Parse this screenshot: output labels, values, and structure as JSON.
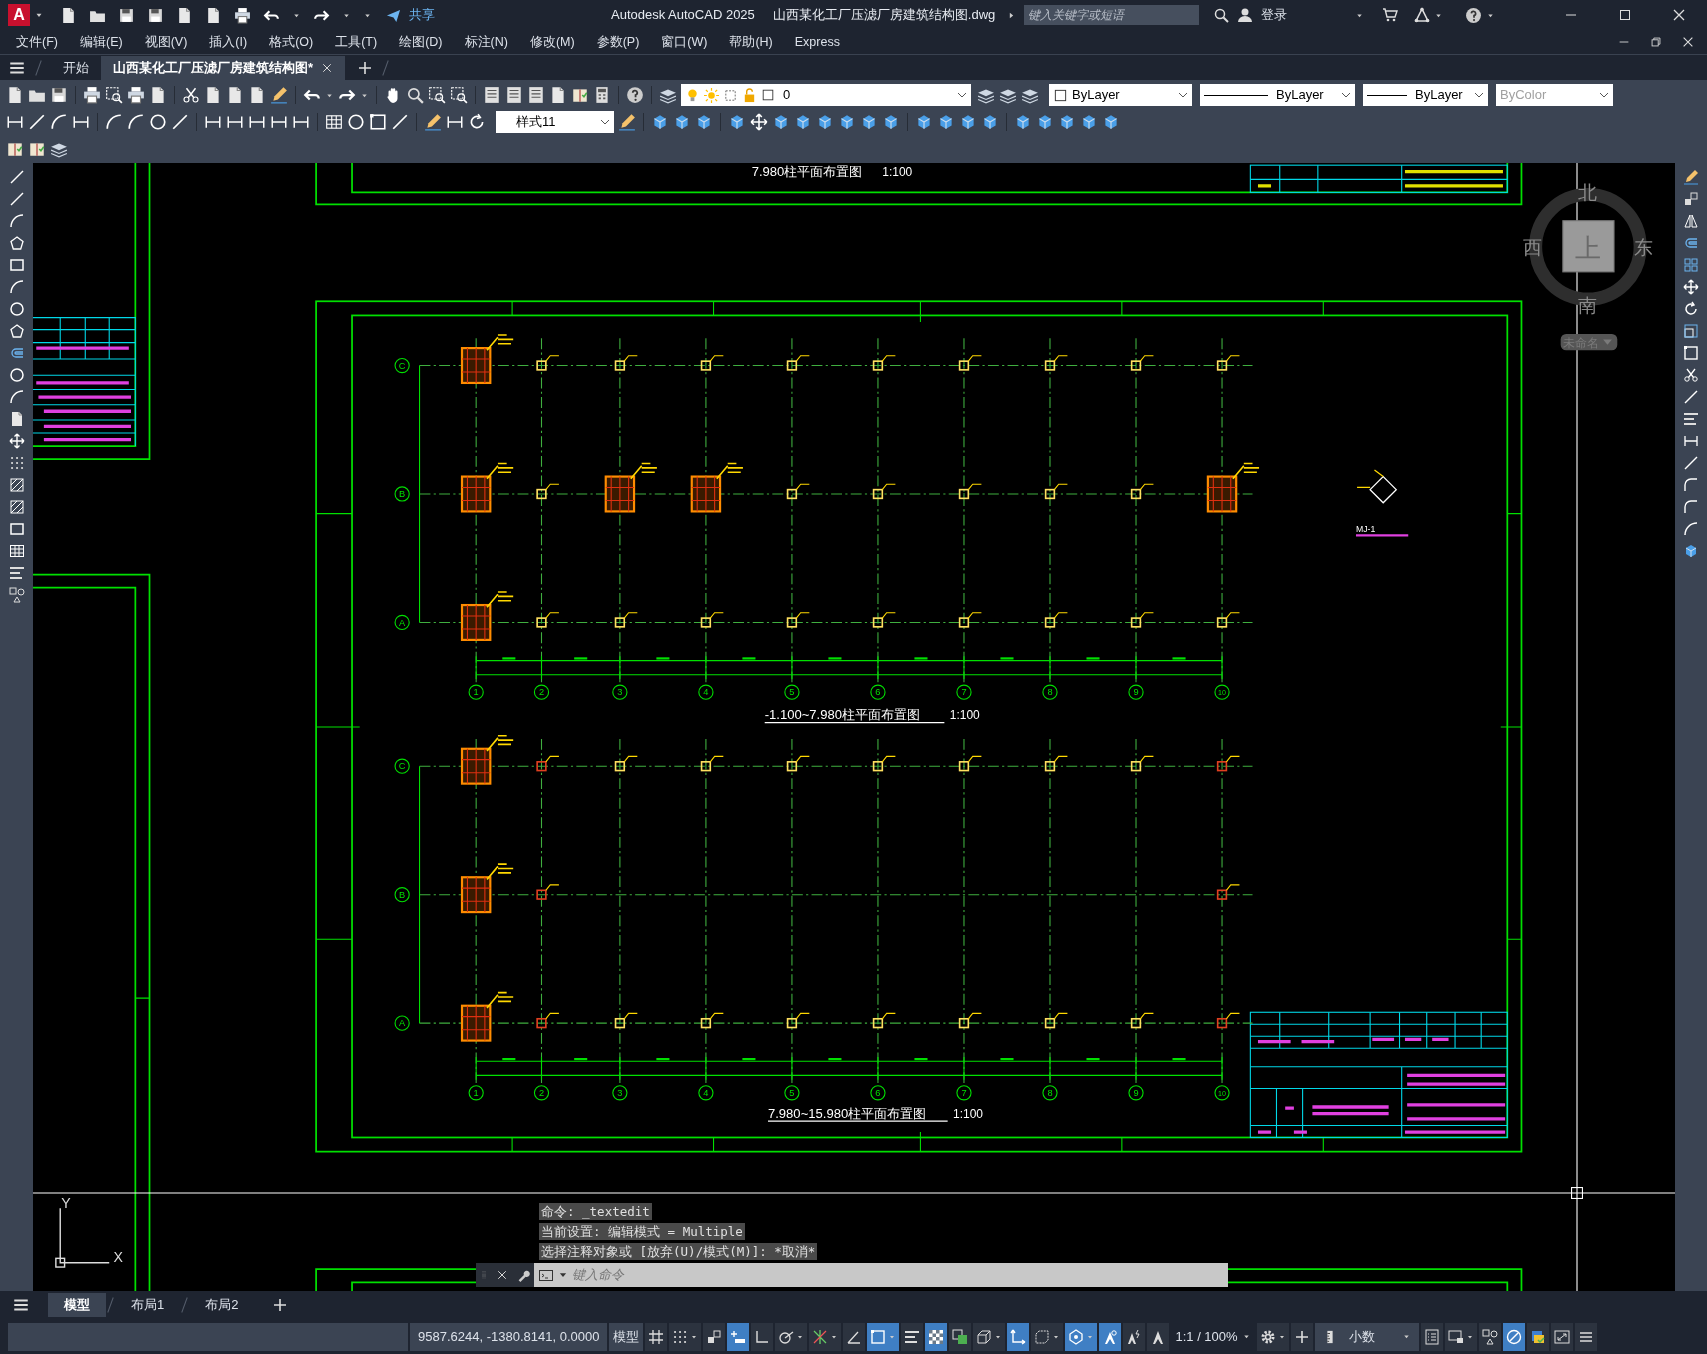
{
  "window": {
    "logo": "A",
    "share": "共享",
    "app_title": "Autodesk AutoCAD 2025",
    "file_title": "山西某化工厂压滤厂房建筑结构图.dwg",
    "search": {
      "placeholder": "键入关键字或短语"
    },
    "login": "登录"
  },
  "menu": [
    "文件(F)",
    "编辑(E)",
    "视图(V)",
    "插入(I)",
    "格式(O)",
    "工具(T)",
    "绘图(D)",
    "标注(N)",
    "修改(M)",
    "参数(P)",
    "窗口(W)",
    "帮助(H)",
    "Express"
  ],
  "doc_tabs": [
    {
      "label": "开始",
      "selected": false
    },
    {
      "label": "山西某化工厂压滤厂房建筑结构图*",
      "selected": true
    }
  ],
  "properties": {
    "layer": "0",
    "color_setting": "ByLayer",
    "linetype": "ByLayer",
    "lineweight": "ByLayer",
    "plot_style": "ByColor",
    "text_style": "样式11"
  },
  "drawing": {
    "top_title": "7.980柱平面布置图",
    "top_scale": "1:100",
    "plans": [
      {
        "title": "-1.100~7.980柱平面布置图",
        "scale": "1:100",
        "columns": [
          "1",
          "2",
          "3",
          "4",
          "5",
          "6",
          "7",
          "8",
          "9",
          "10"
        ],
        "rows": [
          "C",
          "B",
          "A"
        ]
      },
      {
        "title": "7.980~15.980柱平面布置图",
        "scale": "1:100",
        "columns": [
          "1",
          "2",
          "3",
          "4",
          "5",
          "6",
          "7",
          "8",
          "9",
          "10"
        ],
        "rows": [
          "C",
          "B",
          "A"
        ]
      }
    ],
    "detail_label": "MJ-1"
  },
  "viewcube": {
    "north": "北",
    "south": "南",
    "west": "西",
    "east": "东",
    "face": "上",
    "ucs_name": "未命名"
  },
  "ucs": {
    "x": "X",
    "y": "Y"
  },
  "command_history": [
    "命令: _textedit",
    "当前设置: 编辑模式 = Multiple",
    "选择注释对象或 [放弃(U)/模式(M)]: *取消*"
  ],
  "command_line": {
    "placeholder": "键入命令"
  },
  "layout_tabs": [
    {
      "label": "模型",
      "selected": true
    },
    {
      "label": "布局1",
      "selected": false
    },
    {
      "label": "布局2",
      "selected": false
    }
  ],
  "status": {
    "coords": "9587.6244, -1380.8141, 0.0000",
    "space": "模型",
    "items": [
      {
        "kind": "grid",
        "on": false,
        "dropdown": false
      },
      {
        "kind": "dots",
        "on": false,
        "dropdown": true
      },
      {
        "kind": "infer",
        "on": false,
        "dropdown": false
      },
      {
        "kind": "dyninput",
        "on": true,
        "dropdown": false
      },
      {
        "kind": "ortho",
        "on": false,
        "dropdown": false
      },
      {
        "kind": "polar",
        "on": false,
        "dropdown": true
      },
      {
        "kind": "otrack",
        "on": false,
        "dropdown": true
      },
      {
        "kind": "angle",
        "on": false,
        "dropdown": false
      },
      {
        "kind": "selrect",
        "on": true,
        "dropdown": true
      },
      {
        "kind": "lineweight",
        "on": false,
        "dropdown": false
      },
      {
        "kind": "transparency",
        "on": true,
        "dropdown": false
      },
      {
        "kind": "cycling",
        "on": false,
        "dropdown": false
      },
      {
        "kind": "osnap3d",
        "on": false,
        "dropdown": true
      },
      {
        "kind": "dynucs",
        "on": true,
        "dropdown": false
      },
      {
        "kind": "filter",
        "on": false,
        "dropdown": true
      },
      {
        "kind": "gizmo",
        "on": true,
        "dropdown": true
      },
      {
        "kind": "annovis",
        "on": true,
        "dropdown": false
      },
      {
        "kind": "autoscale",
        "on": false,
        "dropdown": false
      },
      {
        "kind": "annoscale",
        "on": false,
        "dropdown": false
      },
      {
        "kind": "scale",
        "label": "1:1 / 100%"
      },
      {
        "kind": "gear",
        "on": false,
        "dropdown": true
      },
      {
        "kind": "plus",
        "on": false,
        "dropdown": false
      },
      {
        "kind": "units",
        "label": "小数"
      },
      {
        "kind": "properties",
        "on": false,
        "dropdown": false
      },
      {
        "kind": "monitor",
        "on": false,
        "dropdown": true
      },
      {
        "kind": "shapes",
        "on": false,
        "dropdown": false
      },
      {
        "kind": "isolate",
        "on": true,
        "dropdown": false
      },
      {
        "kind": "hardware",
        "on": false,
        "dropdown": false
      },
      {
        "kind": "fullscreen",
        "on": false,
        "dropdown": false
      },
      {
        "kind": "menu",
        "on": false,
        "dropdown": false
      }
    ]
  }
}
